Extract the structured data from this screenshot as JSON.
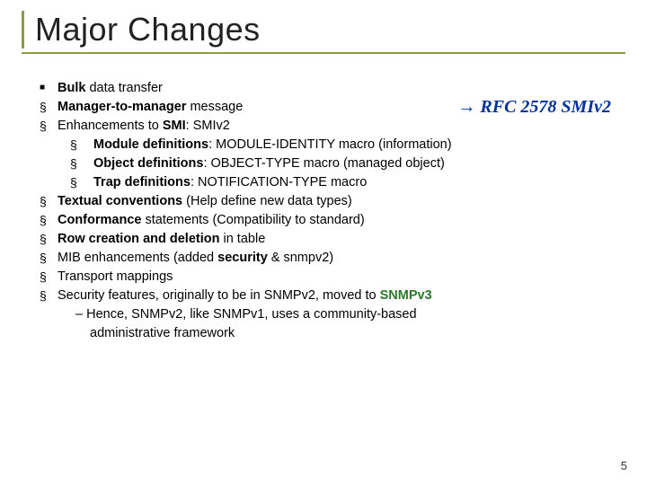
{
  "title": "Major Changes",
  "callout": {
    "arrow": "→",
    "text": "RFC 2578 SMIv2"
  },
  "b": {
    "bulk": "Bulk",
    "data_transfer": " data transfer",
    "m2m": "Manager-to-manager",
    "msg": " message",
    "enh_pre": "Enhancements to ",
    "smi": "SMI",
    "enh_post": ": SMIv2",
    "module": "Module",
    "defs": " definitions",
    "module_post": ": MODULE-IDENTITY macro (information)",
    "object": "Object",
    "object_post": ": OBJECT-TYPE macro (managed object)",
    "trap": "Trap",
    "trap_post": ": NOTIFICATION-TYPE macro",
    "textual": "Textual conventions",
    "textual_post": " (Help define new data types)",
    "conf": "Conformance",
    "conf_post": " statements (Compatibility to standard)",
    "row": "Row creation and deletion",
    "row_post": " in table",
    "mib_pre": "MIB enhancements (added ",
    "sec": "security",
    "mib_post": " & snmpv2)",
    "transport": "Transport mappings",
    "secfeat_pre": "Security features, originally to be in SNMPv2, moved to ",
    "snmpv3": "SNMPv3",
    "dash": "– Hence, SNMPv2, like SNMPv1, uses a community-based",
    "dash2": "administrative framework"
  },
  "page": "5"
}
